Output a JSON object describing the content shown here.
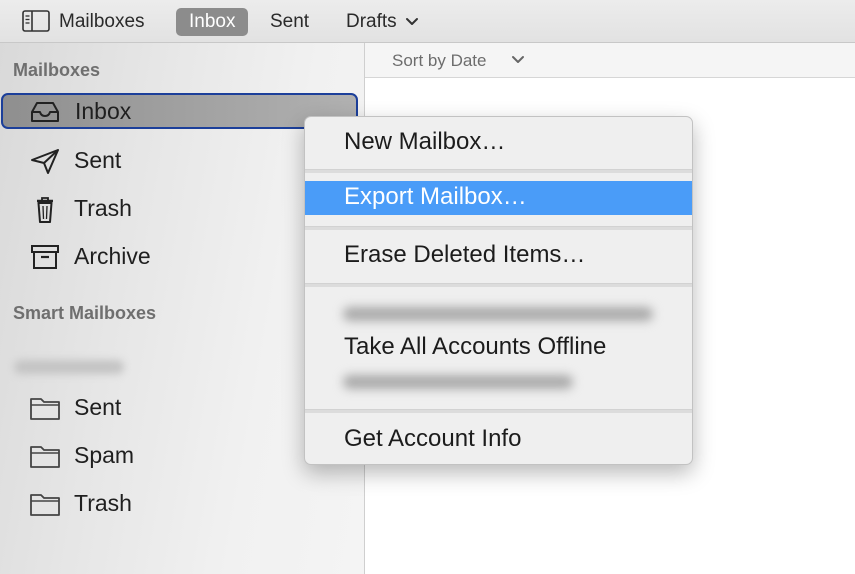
{
  "toolbar": {
    "sidebar_icon": "sidebar-toggle-icon",
    "mailboxes": "Mailboxes",
    "inbox": "Inbox",
    "sent": "Sent",
    "drafts": "Drafts",
    "active_color": "#8c8c8c"
  },
  "sidebar": {
    "mailboxes_header": "Mailboxes",
    "items": [
      {
        "label": "Inbox",
        "icon": "inbox-tray-icon",
        "selected": true
      },
      {
        "label": "Sent",
        "icon": "paper-plane-icon"
      },
      {
        "label": "Trash",
        "icon": "trash-can-icon"
      },
      {
        "label": "Archive",
        "icon": "archive-box-icon"
      }
    ],
    "smart_header": "Smart Mailboxes",
    "account_items": [
      {
        "label": "Sent",
        "icon": "folder-icon"
      },
      {
        "label": "Spam",
        "icon": "folder-icon"
      },
      {
        "label": "Trash",
        "icon": "folder-icon"
      }
    ],
    "selection_border_color": "#1c3f9a"
  },
  "list": {
    "sort_label": "Sort by Date"
  },
  "context_menu": {
    "items": [
      {
        "label": "New Mailbox…"
      },
      {
        "label": "Export Mailbox…",
        "highlighted": true
      },
      {
        "label": "Erase Deleted Items…"
      },
      {
        "label": "Take All Accounts Offline"
      },
      {
        "label": "Get Account Info"
      }
    ],
    "highlight_color": "#4a9cf8"
  }
}
